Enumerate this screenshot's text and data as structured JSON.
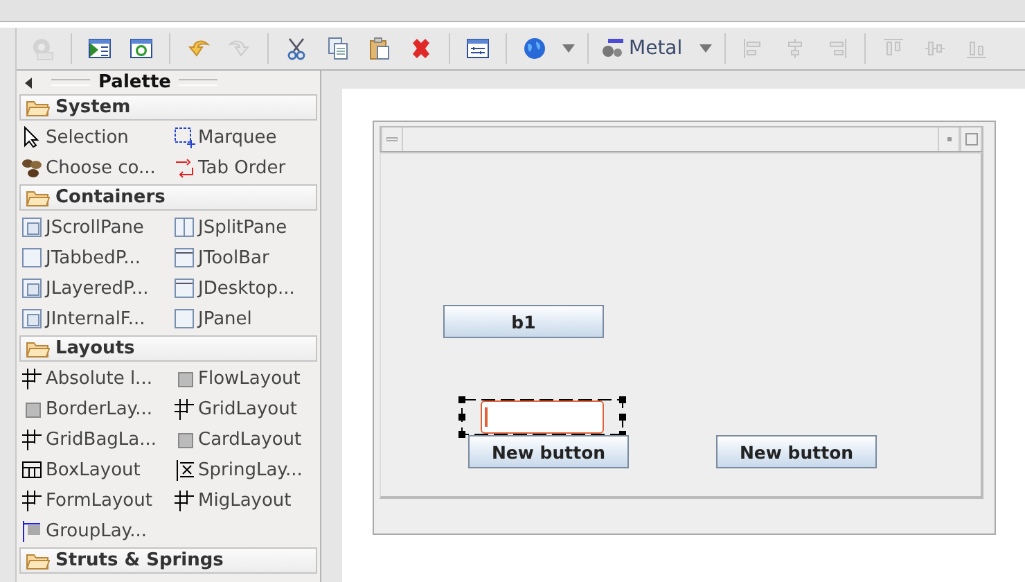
{
  "toolbar": {
    "items": [
      {
        "kind": "button",
        "disabled": true
      },
      {
        "kind": "separator"
      },
      {
        "kind": "button",
        "disabled": false
      },
      {
        "kind": "button",
        "disabled": false
      },
      {
        "kind": "separator"
      },
      {
        "kind": "button",
        "disabled": false
      },
      {
        "kind": "button",
        "disabled": true
      },
      {
        "kind": "separator"
      },
      {
        "kind": "button",
        "disabled": false
      },
      {
        "kind": "button",
        "disabled": false
      },
      {
        "kind": "button",
        "disabled": false
      },
      {
        "kind": "button",
        "disabled": false
      },
      {
        "kind": "separator"
      },
      {
        "kind": "button",
        "disabled": false
      },
      {
        "kind": "separator"
      },
      {
        "kind": "button",
        "disabled": false
      },
      {
        "kind": "menu-arrow"
      },
      {
        "kind": "separator"
      },
      {
        "kind": "dropdown",
        "label": "Metal"
      },
      {
        "kind": "separator"
      },
      {
        "kind": "button",
        "disabled": true
      },
      {
        "kind": "button",
        "disabled": true
      },
      {
        "kind": "button",
        "disabled": true
      },
      {
        "kind": "separator"
      },
      {
        "kind": "button",
        "disabled": true
      },
      {
        "kind": "button",
        "disabled": true
      },
      {
        "kind": "button",
        "disabled": true
      }
    ]
  },
  "palette": {
    "title": "Palette",
    "categories": [
      {
        "label": "System",
        "items": [
          "Selection",
          "Marquee",
          "Choose co...",
          "Tab Order"
        ]
      },
      {
        "label": "Containers",
        "items": [
          "JScrollPane",
          "JSplitPane",
          "JTabbedP...",
          "JToolBar",
          "JLayeredP...",
          "JDesktop...",
          "JInternalF...",
          "JPanel"
        ]
      },
      {
        "label": "Layouts",
        "items": [
          "Absolute l...",
          "FlowLayout",
          "BorderLay...",
          "GridLayout",
          "GridBagLa...",
          "CardLayout",
          "BoxLayout",
          "SpringLay...",
          "FormLayout",
          "MigLayout",
          "GroupLay..."
        ]
      },
      {
        "label": "Struts & Springs"
      }
    ]
  },
  "canvas": {
    "components": [
      {
        "kind": "button",
        "label": "b1",
        "selected": false
      },
      {
        "kind": "text-field",
        "selected": true
      },
      {
        "kind": "button",
        "label": "New button",
        "selected": false
      },
      {
        "kind": "button",
        "label": "New button",
        "selected": false
      }
    ]
  }
}
